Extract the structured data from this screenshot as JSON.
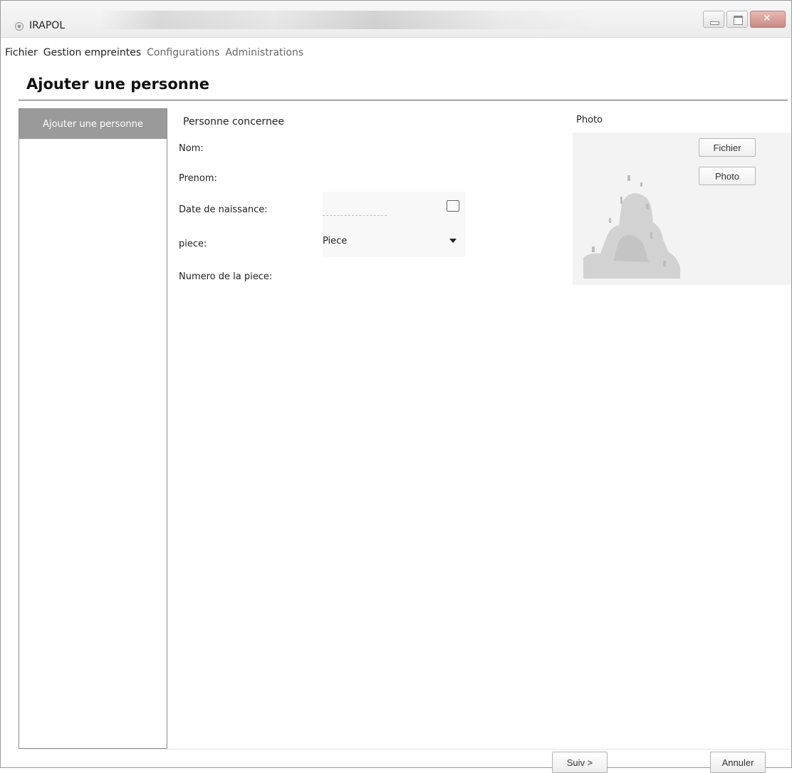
{
  "window": {
    "title": "IRAPOL"
  },
  "menu": {
    "items": [
      "Fichier",
      "Gestion empreintes",
      "Configurations",
      "Administrations"
    ]
  },
  "page": {
    "title": "Ajouter une personne"
  },
  "sidebar": {
    "items": [
      {
        "label": "Ajouter une personne",
        "selected": true
      }
    ]
  },
  "form": {
    "section_title": "Personne concernee",
    "fields": {
      "nom": {
        "label": "Nom:",
        "value": ""
      },
      "prenom": {
        "label": "Prenom:",
        "value": ""
      },
      "date_naissance": {
        "label": "Date de naissance:",
        "value": ""
      },
      "piece": {
        "label": "piece:",
        "selected": "Piece"
      },
      "numero_piece": {
        "label": "Numero de la piece:",
        "value": ""
      }
    }
  },
  "photo": {
    "label": "Photo",
    "buttons": [
      "Fichier",
      "Photo"
    ]
  },
  "footer": {
    "buttons": [
      "Suiv >",
      "Annuler"
    ]
  },
  "icons": [
    "app-icon",
    "minimize-icon",
    "maximize-icon",
    "close-icon",
    "calendar-icon",
    "chevron-down-icon",
    "photo-placeholder-icon"
  ],
  "colors": {
    "sidebar_selected_bg": "#9a9a9a",
    "sidebar_selected_text": "#ffffff"
  }
}
